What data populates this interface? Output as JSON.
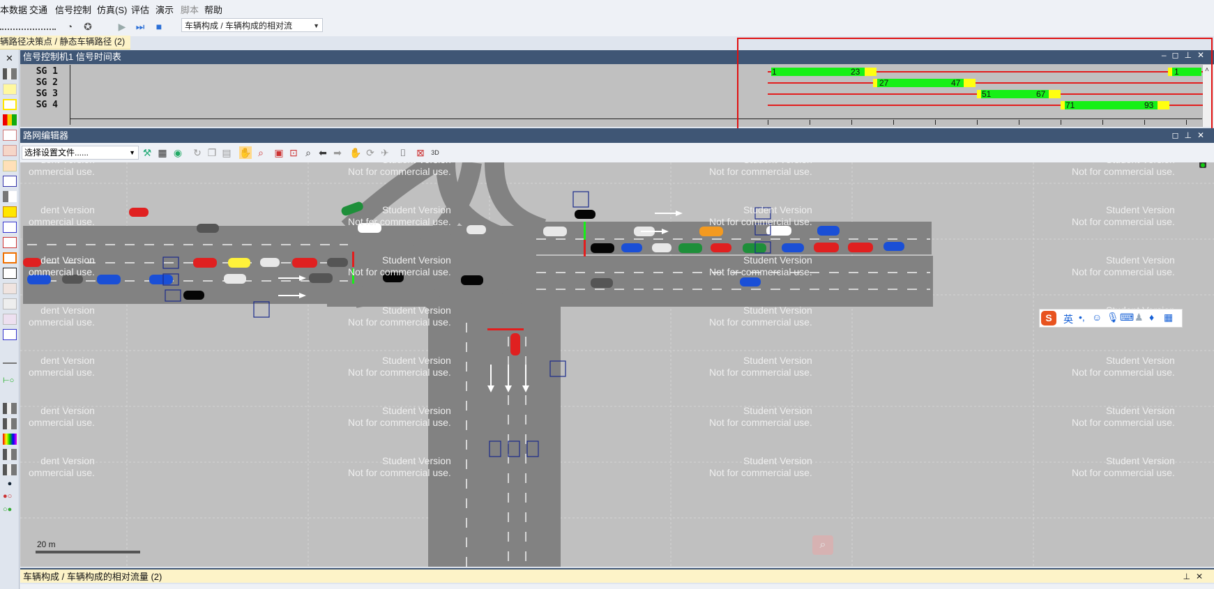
{
  "menu": {
    "items": [
      "本数据",
      "交通",
      "信号控制",
      "仿真(S)",
      "评估",
      "演示",
      "脚本",
      "帮助"
    ]
  },
  "toolbar": {
    "vehicle_composition_combo": "车辆构成 / 车辆构成的相对流"
  },
  "routes_tab": {
    "label": "辆路径决策点 / 静态车辆路径 (2)"
  },
  "signal_window": {
    "title": "信号控制机1 信号时间表",
    "signal_groups": [
      {
        "label": "SG 1",
        "start": "1",
        "end": "23",
        "restart": "1"
      },
      {
        "label": "SG 2",
        "start": "27",
        "end": "47"
      },
      {
        "label": "SG 3",
        "start": "51",
        "end": "67"
      },
      {
        "label": "SG 4",
        "start": "71",
        "end": "93"
      }
    ],
    "colors": {
      "green": "#17f017",
      "amber": "#ffff10",
      "red": "#e31d1d"
    }
  },
  "network_editor": {
    "title": "路网编辑器",
    "settings_combo": "选择设置文件......",
    "scale_label": "20 m",
    "watermark": {
      "line1": "Student Version",
      "line2": "Not for commercial use.",
      "line1_cut": "dent Version",
      "line2_cut": "ommercial use."
    },
    "ime": {
      "char": "英",
      "logo": "S"
    }
  },
  "bottom_panel": {
    "title": "车辆构成 / 车辆构成的相对流量 (2)"
  }
}
